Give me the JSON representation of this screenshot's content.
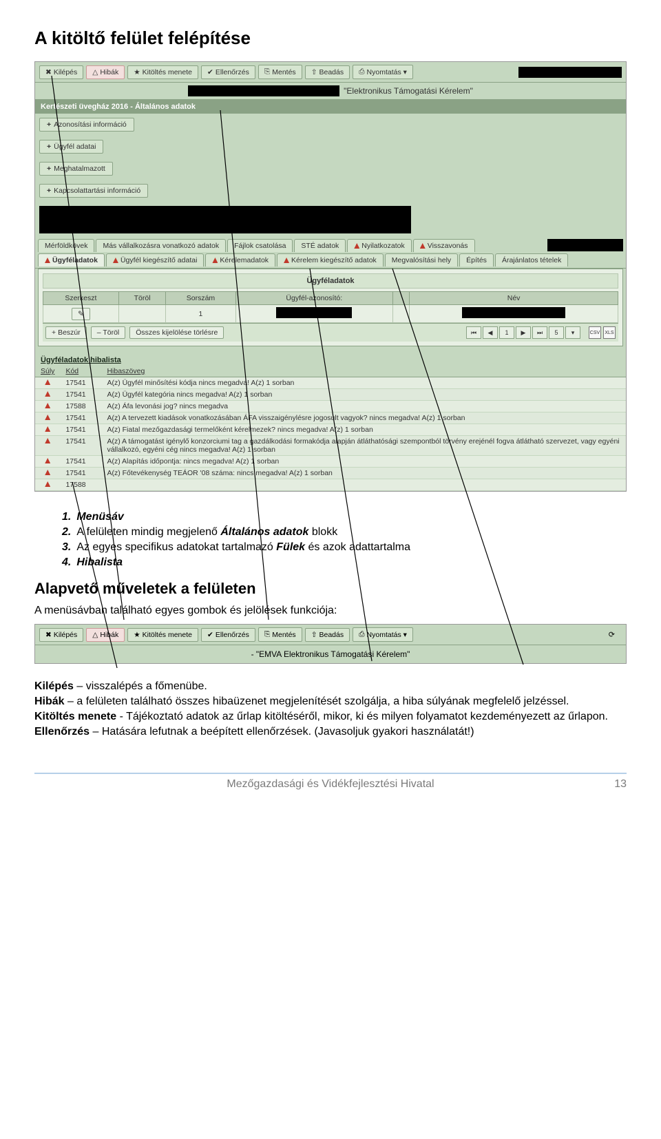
{
  "page_title": "A kitöltő felület felépítése",
  "screenshot1": {
    "toolbar": [
      {
        "icon": "✖",
        "label": "Kilépés",
        "err": false
      },
      {
        "icon": "△",
        "label": "Hibák",
        "err": true
      },
      {
        "icon": "★",
        "label": "Kitöltés menete",
        "err": false
      },
      {
        "icon": "✔",
        "label": "Ellenőrzés",
        "err": false
      },
      {
        "icon": "⎘",
        "label": "Mentés",
        "err": false
      },
      {
        "icon": "⇧",
        "label": "Beadás",
        "err": false
      },
      {
        "icon": "⎙",
        "label": "Nyomtatás ▾",
        "err": false
      }
    ],
    "subheader_suffix": "\"Elektronikus Támogatási Kérelem\"",
    "section_title": "Kertészeti üvegház 2016 - Általános adatok",
    "panels": [
      "Azonosítási információ",
      "Ügyfél adatai",
      "Meghatalmazott",
      "Kapcsolattartási információ"
    ],
    "tabs_row1": [
      {
        "label": "Mérföldkövek",
        "warn": false
      },
      {
        "label": "Más vállalkozásra vonatkozó adatok",
        "warn": false
      },
      {
        "label": "Fájlok csatolása",
        "warn": false
      },
      {
        "label": "STÉ adatok",
        "warn": false
      },
      {
        "label": "Nyilatkozatok",
        "warn": true
      },
      {
        "label": "Visszavonás",
        "warn": true
      }
    ],
    "tabs_row2": [
      {
        "label": "Ügyféladatok",
        "warn": true,
        "active": true
      },
      {
        "label": "Ügyfél kiegészítő adatai",
        "warn": true
      },
      {
        "label": "Kérelemadatok",
        "warn": true
      },
      {
        "label": "Kérelem kiegészítő adatok",
        "warn": true
      },
      {
        "label": "Megvalósítási hely",
        "warn": false
      },
      {
        "label": "Építés",
        "warn": false
      },
      {
        "label": "Árajánlatos tételek",
        "warn": false
      }
    ],
    "pane_title": "Ügyféladatok",
    "table_headers": [
      "Szerkeszt",
      "Töröl",
      "Sorszám",
      "Ügyfél-azonosító:",
      "",
      "Név"
    ],
    "table_row": {
      "sorszam": "1"
    },
    "footer_btns": {
      "beszur": "Beszúr",
      "torol": "Töröl",
      "osszes": "Összes kijelölése törlésre",
      "page": "1",
      "size": "5"
    },
    "hiba": {
      "title": "Ügyféladatok hibalista",
      "headers": [
        "Súly",
        "Kód",
        "Hibaszöveg"
      ],
      "rows": [
        {
          "kod": "17541",
          "txt": "A(z) Ügyfél minősítési kódja nincs megadva! A(z) 1 sorban"
        },
        {
          "kod": "17541",
          "txt": "A(z) Ügyfél kategória nincs megadva! A(z) 1 sorban"
        },
        {
          "kod": "17588",
          "txt": "A(z) Áfa levonási jog? nincs megadva"
        },
        {
          "kod": "17541",
          "txt": "A(z) A tervezett kiadások vonatkozásában ÁFA visszaigénylésre jogosult vagyok? nincs megadva! A(z) 1 sorban"
        },
        {
          "kod": "17541",
          "txt": "A(z) Fiatal mezőgazdasági termelőként kérelmezek? nincs megadva! A(z) 1 sorban"
        },
        {
          "kod": "17541",
          "txt": "A(z) A támogatást igénylő konzorciumi tag a gazdálkodási formakódja alapján átláthatósági szempontból törvény erejénél fogva átlátható szervezet, vagy egyéni vállalkozó, egyéni cég nincs megadva! A(z) 1 sorban"
        },
        {
          "kod": "17541",
          "txt": "A(z) Alapítás időpontja: nincs megadva! A(z) 1 sorban"
        },
        {
          "kod": "17541",
          "txt": "A(z) Főtevékenység TEÁOR '08 száma: nincs megadva! A(z) 1 sorban"
        },
        {
          "kod": "17588",
          "txt": ""
        }
      ]
    }
  },
  "list": [
    {
      "num": "1.",
      "label": "Menüsáv",
      "extra": ""
    },
    {
      "num": "2.",
      "label": "Általános adatok",
      "prefix": "A felületen mindig megjelenő ",
      "suffix": " blokk"
    },
    {
      "num": "3.",
      "label": "Fülek",
      "prefix": "Az egyes specifikus adatokat tartalmazó ",
      "suffix": " és azok adattartalma"
    },
    {
      "num": "4.",
      "label": "Hibalista",
      "extra": ""
    }
  ],
  "section2_title": "Alapvető műveletek a felületen",
  "section2_intro": "A menüsávban található egyes gombok és jelölések funkciója:",
  "screenshot2": {
    "toolbar": [
      {
        "icon": "✖",
        "label": "Kilépés",
        "err": false
      },
      {
        "icon": "△",
        "label": "Hibák",
        "err": true
      },
      {
        "icon": "★",
        "label": "Kitöltés menete",
        "err": false
      },
      {
        "icon": "✔",
        "label": "Ellenőrzés",
        "err": false
      },
      {
        "icon": "⎘",
        "label": "Mentés",
        "err": false
      },
      {
        "icon": "⇧",
        "label": "Beadás",
        "err": false
      },
      {
        "icon": "⎙",
        "label": "Nyomtatás ▾",
        "err": false
      }
    ],
    "subheader": "- \"EMVA Elektronikus Támogatási Kérelem\""
  },
  "defs": [
    {
      "term": "Kilépés",
      "sep": " – ",
      "text": "visszalépés a főmenübe."
    },
    {
      "term": "Hibák",
      "sep": " – ",
      "text": "a felületen található összes hibaüzenet megjelenítését szolgálja, a hiba súlyának megfelelő jelzéssel."
    },
    {
      "term": "Kitöltés menete",
      "sep": " - ",
      "text": "Tájékoztató adatok az űrlap kitöltéséről, mikor, ki és milyen folyamatot kezdeményezett az űrlapon."
    },
    {
      "term": "Ellenőrzés",
      "sep": " – ",
      "text": "Hatására lefutnak a beépített ellenőrzések. (Javasoljuk gyakori használatát!)"
    }
  ],
  "footer": {
    "org": "Mezőgazdasági és Vidékfejlesztési Hivatal",
    "page": "13"
  }
}
